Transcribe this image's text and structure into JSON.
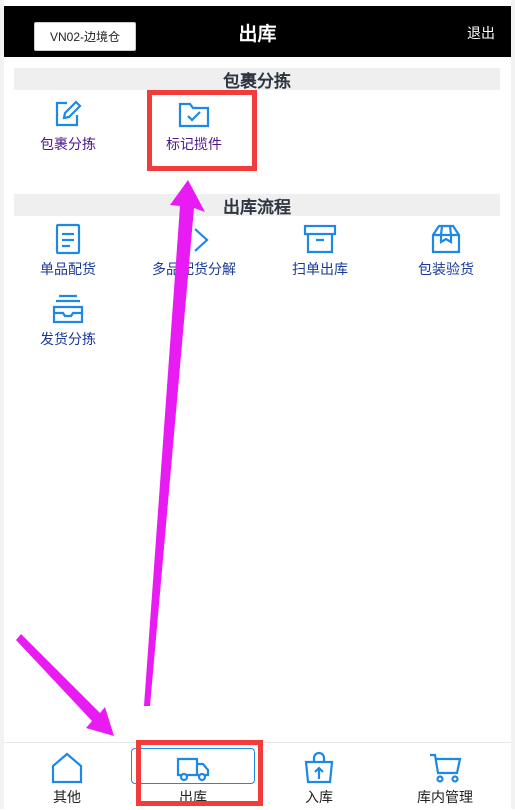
{
  "header": {
    "warehouse": "VN02-边境仓",
    "title": "出库",
    "logout": "退出"
  },
  "sections": [
    {
      "title": "包裹分拣",
      "items": [
        {
          "label": "包裹分拣",
          "icon": "edit-icon"
        },
        {
          "label": "标记揽件",
          "icon": "folder-check-icon"
        }
      ]
    },
    {
      "title": "出库流程",
      "items": [
        {
          "label": "单品配货",
          "icon": "document-icon"
        },
        {
          "label": "多品配货分解",
          "icon": "split-icon"
        },
        {
          "label": "扫单出库",
          "icon": "archive-box-icon"
        },
        {
          "label": "包装验货",
          "icon": "package-icon"
        },
        {
          "label": "发货分拣",
          "icon": "stacked-tray-icon"
        }
      ]
    }
  ],
  "bottom_nav": [
    {
      "label": "其他",
      "icon": "home-icon"
    },
    {
      "label": "出库",
      "icon": "truck-icon",
      "active": true
    },
    {
      "label": "入库",
      "icon": "shopping-bag-arrow-icon"
    },
    {
      "label": "库内管理",
      "icon": "cart-icon"
    }
  ],
  "colors": {
    "header_bg": "#000000",
    "icon_blue": "#1e88e5",
    "annotation_red": "#f23b3b",
    "annotation_magenta": "#e81cf2"
  }
}
